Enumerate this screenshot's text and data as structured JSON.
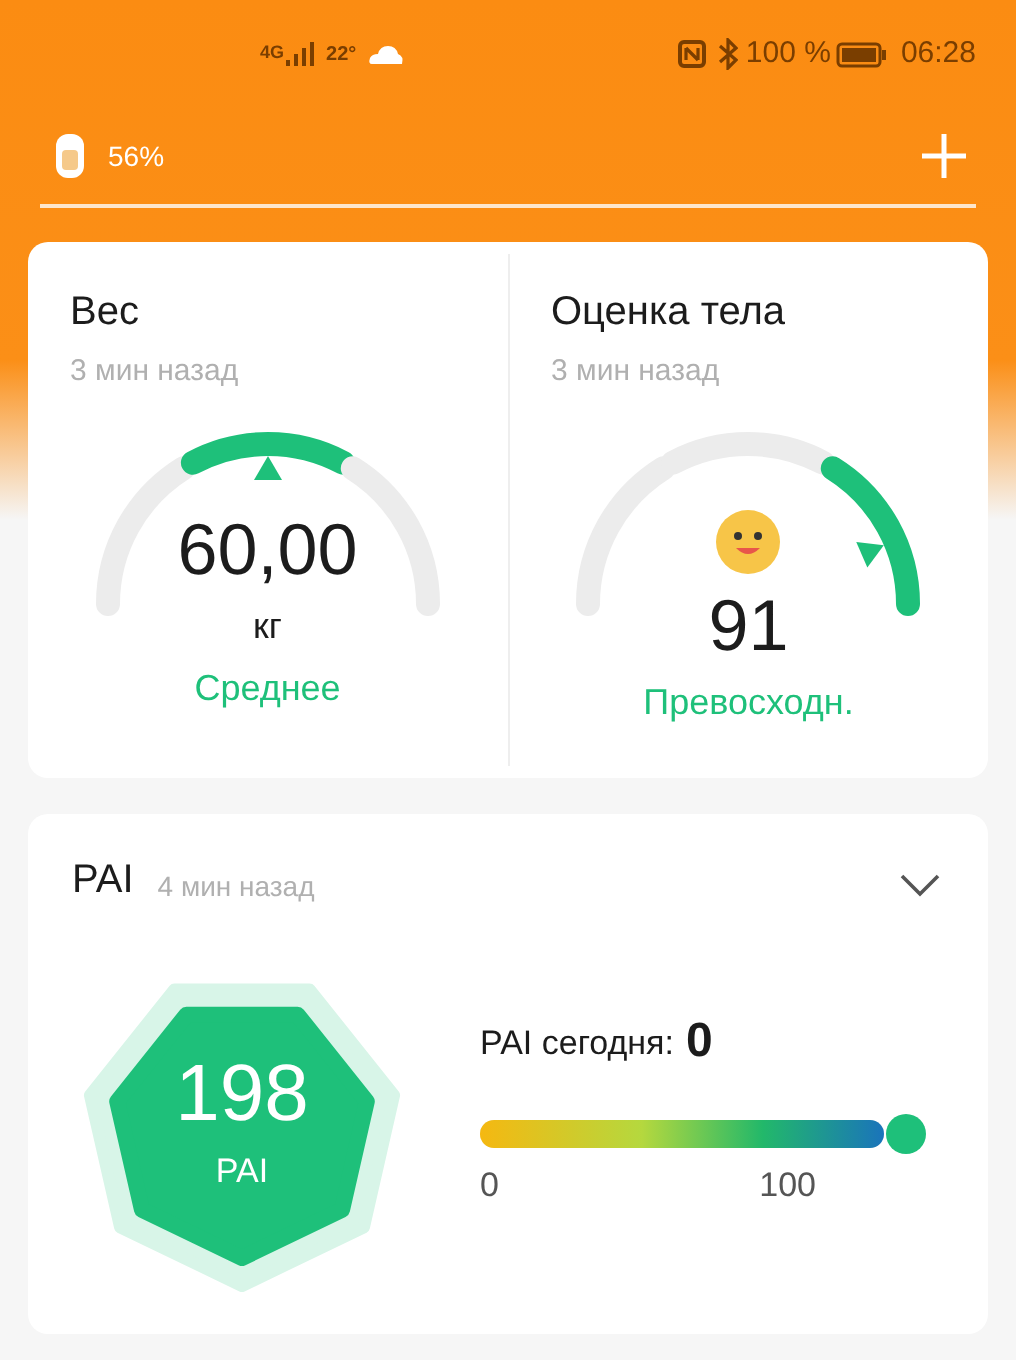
{
  "status_bar": {
    "network": "4G",
    "temperature": "22°",
    "battery": "100 %",
    "time": "06:28"
  },
  "device": {
    "battery": "56%"
  },
  "gauges": [
    {
      "title": "Вес",
      "time": "3 мин назад",
      "value": "60,00",
      "unit": "кг",
      "rating": "Среднее"
    },
    {
      "title": "Оценка тела",
      "time": "3 мин назад",
      "value": "91",
      "rating": "Превосходн."
    }
  ],
  "pai": {
    "title": "PAI",
    "time": "4 мин назад",
    "expanded": false,
    "score": "198",
    "score_label": "PAI",
    "today_label": "PAI сегодня:",
    "today_value": "0",
    "level": 1,
    "min_label": "0",
    "max_label": "100"
  }
}
